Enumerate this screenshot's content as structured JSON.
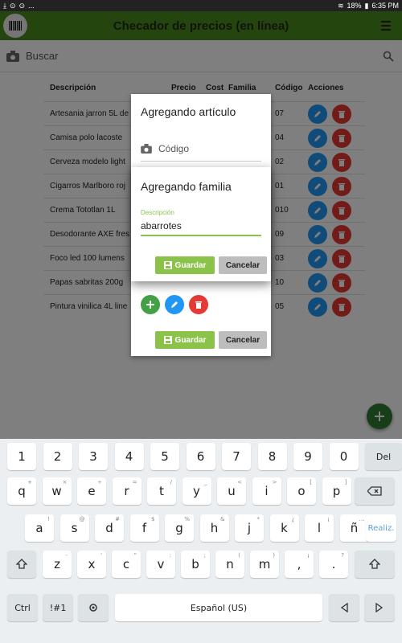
{
  "status": {
    "left_icons": [
      "download-icon",
      "circle-icon",
      "circle-icon",
      "..."
    ],
    "battery": "18%",
    "time": "6:35 PM"
  },
  "appbar": {
    "title": "Checador de precios (en línea)"
  },
  "search": {
    "placeholder": "Buscar"
  },
  "table": {
    "headers": {
      "descripcion": "Descripción",
      "precio": "Precio",
      "cost": "Cost",
      "familia": "Familia",
      "codigo": "Código",
      "acciones": "Acciones"
    },
    "rows": [
      {
        "desc": "Artesania jarron 5L de",
        "code": "07"
      },
      {
        "desc": "Camisa polo lacoste",
        "code": "04"
      },
      {
        "desc": "Cerveza modelo light",
        "code": "02"
      },
      {
        "desc": "Cigarros Marlboro roj",
        "code": "01"
      },
      {
        "desc": "Crema Tototlan 1L",
        "code": "010"
      },
      {
        "desc": "Desodorante AXE fres",
        "code": "09"
      },
      {
        "desc": "Foco led 100 lumens",
        "code": "03"
      },
      {
        "desc": "Papas sabritas 200g",
        "code": "10"
      },
      {
        "desc": "Pintura vinilica 4L line",
        "code": "05"
      }
    ]
  },
  "dialog_article": {
    "title": "Agregando artículo",
    "code_placeholder": "Código",
    "save_label": "Guardar",
    "cancel_label": "Cancelar"
  },
  "dialog_family": {
    "title": "Agregando familia",
    "field_label": "Descripción",
    "field_value": "abarrotes",
    "save_label": "Guardar",
    "cancel_label": "Cancelar"
  },
  "keyboard": {
    "row1": [
      "1",
      "2",
      "3",
      "4",
      "5",
      "6",
      "7",
      "8",
      "9",
      "0",
      "Del"
    ],
    "row2": [
      [
        "q",
        "+"
      ],
      [
        "w",
        "×"
      ],
      [
        "e",
        "÷"
      ],
      [
        "r",
        "="
      ],
      [
        "t",
        "/"
      ],
      [
        "y",
        "_"
      ],
      [
        "u",
        "<"
      ],
      [
        "i",
        ">"
      ],
      [
        "o",
        "["
      ],
      [
        "p",
        "]"
      ]
    ],
    "row3": [
      [
        "a",
        "!"
      ],
      [
        "s",
        "@"
      ],
      [
        "d",
        "#"
      ],
      [
        "f",
        "$"
      ],
      [
        "g",
        "%"
      ],
      [
        "h",
        "&"
      ],
      [
        "j",
        "*"
      ],
      [
        "k",
        "¿"
      ],
      [
        "l",
        "¡"
      ],
      [
        "ñ",
        "…"
      ]
    ],
    "realiz": "Realiz.",
    "row4": [
      [
        "z",
        "-"
      ],
      [
        "x",
        "'"
      ],
      [
        "c",
        "\""
      ],
      [
        "v",
        ":"
      ],
      [
        "b",
        ";"
      ],
      [
        "n",
        "("
      ],
      [
        "m",
        ")"
      ],
      [
        ",",
        "¡"
      ],
      [
        ".",
        "?"
      ]
    ],
    "ctrl": "Ctrl",
    "sym": "!#1",
    "space": "Español (US)"
  },
  "colors": {
    "appbar": "#4a8a1f",
    "accent": "#8bc34a",
    "edit": "#2196f3",
    "delete": "#e53935"
  }
}
